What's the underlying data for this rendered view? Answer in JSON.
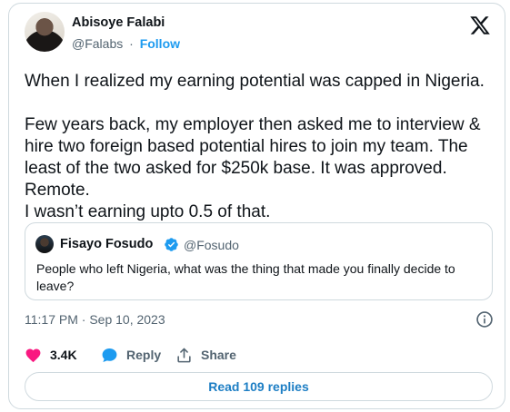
{
  "author": {
    "name": "Abisoye Falabi",
    "handle": "@Falabs",
    "separator": "·",
    "follow_label": "Follow"
  },
  "tweet": {
    "text": "When I realized my earning potential was capped in Nigeria.\n\nFew years back, my employer then asked me to interview &\nhire two foreign based potential hires to join my team. The\nleast of the two asked for $250k base. It was approved.\nRemote.\nI wasn’t earning upto 0.5 of that.",
    "timestamp": "11:17 PM · Sep 10, 2023"
  },
  "quoted_tweet": {
    "name": "Fisayo Fosudo",
    "handle": "@Fosudo",
    "text": "People who left Nigeria, what was the thing that made you finally decide to leave?"
  },
  "actions": {
    "like_count": "3.4K",
    "reply_label": "Reply",
    "share_label": "Share",
    "read_replies_label": "Read 109 replies"
  },
  "colors": {
    "accent": "#1d9bf0",
    "like": "#f91880",
    "muted": "#536471",
    "border": "#cfd9de"
  },
  "icons": [
    "x-logo-icon",
    "verified-badge-icon",
    "info-icon",
    "heart-icon",
    "reply-bubble-icon",
    "share-icon"
  ]
}
